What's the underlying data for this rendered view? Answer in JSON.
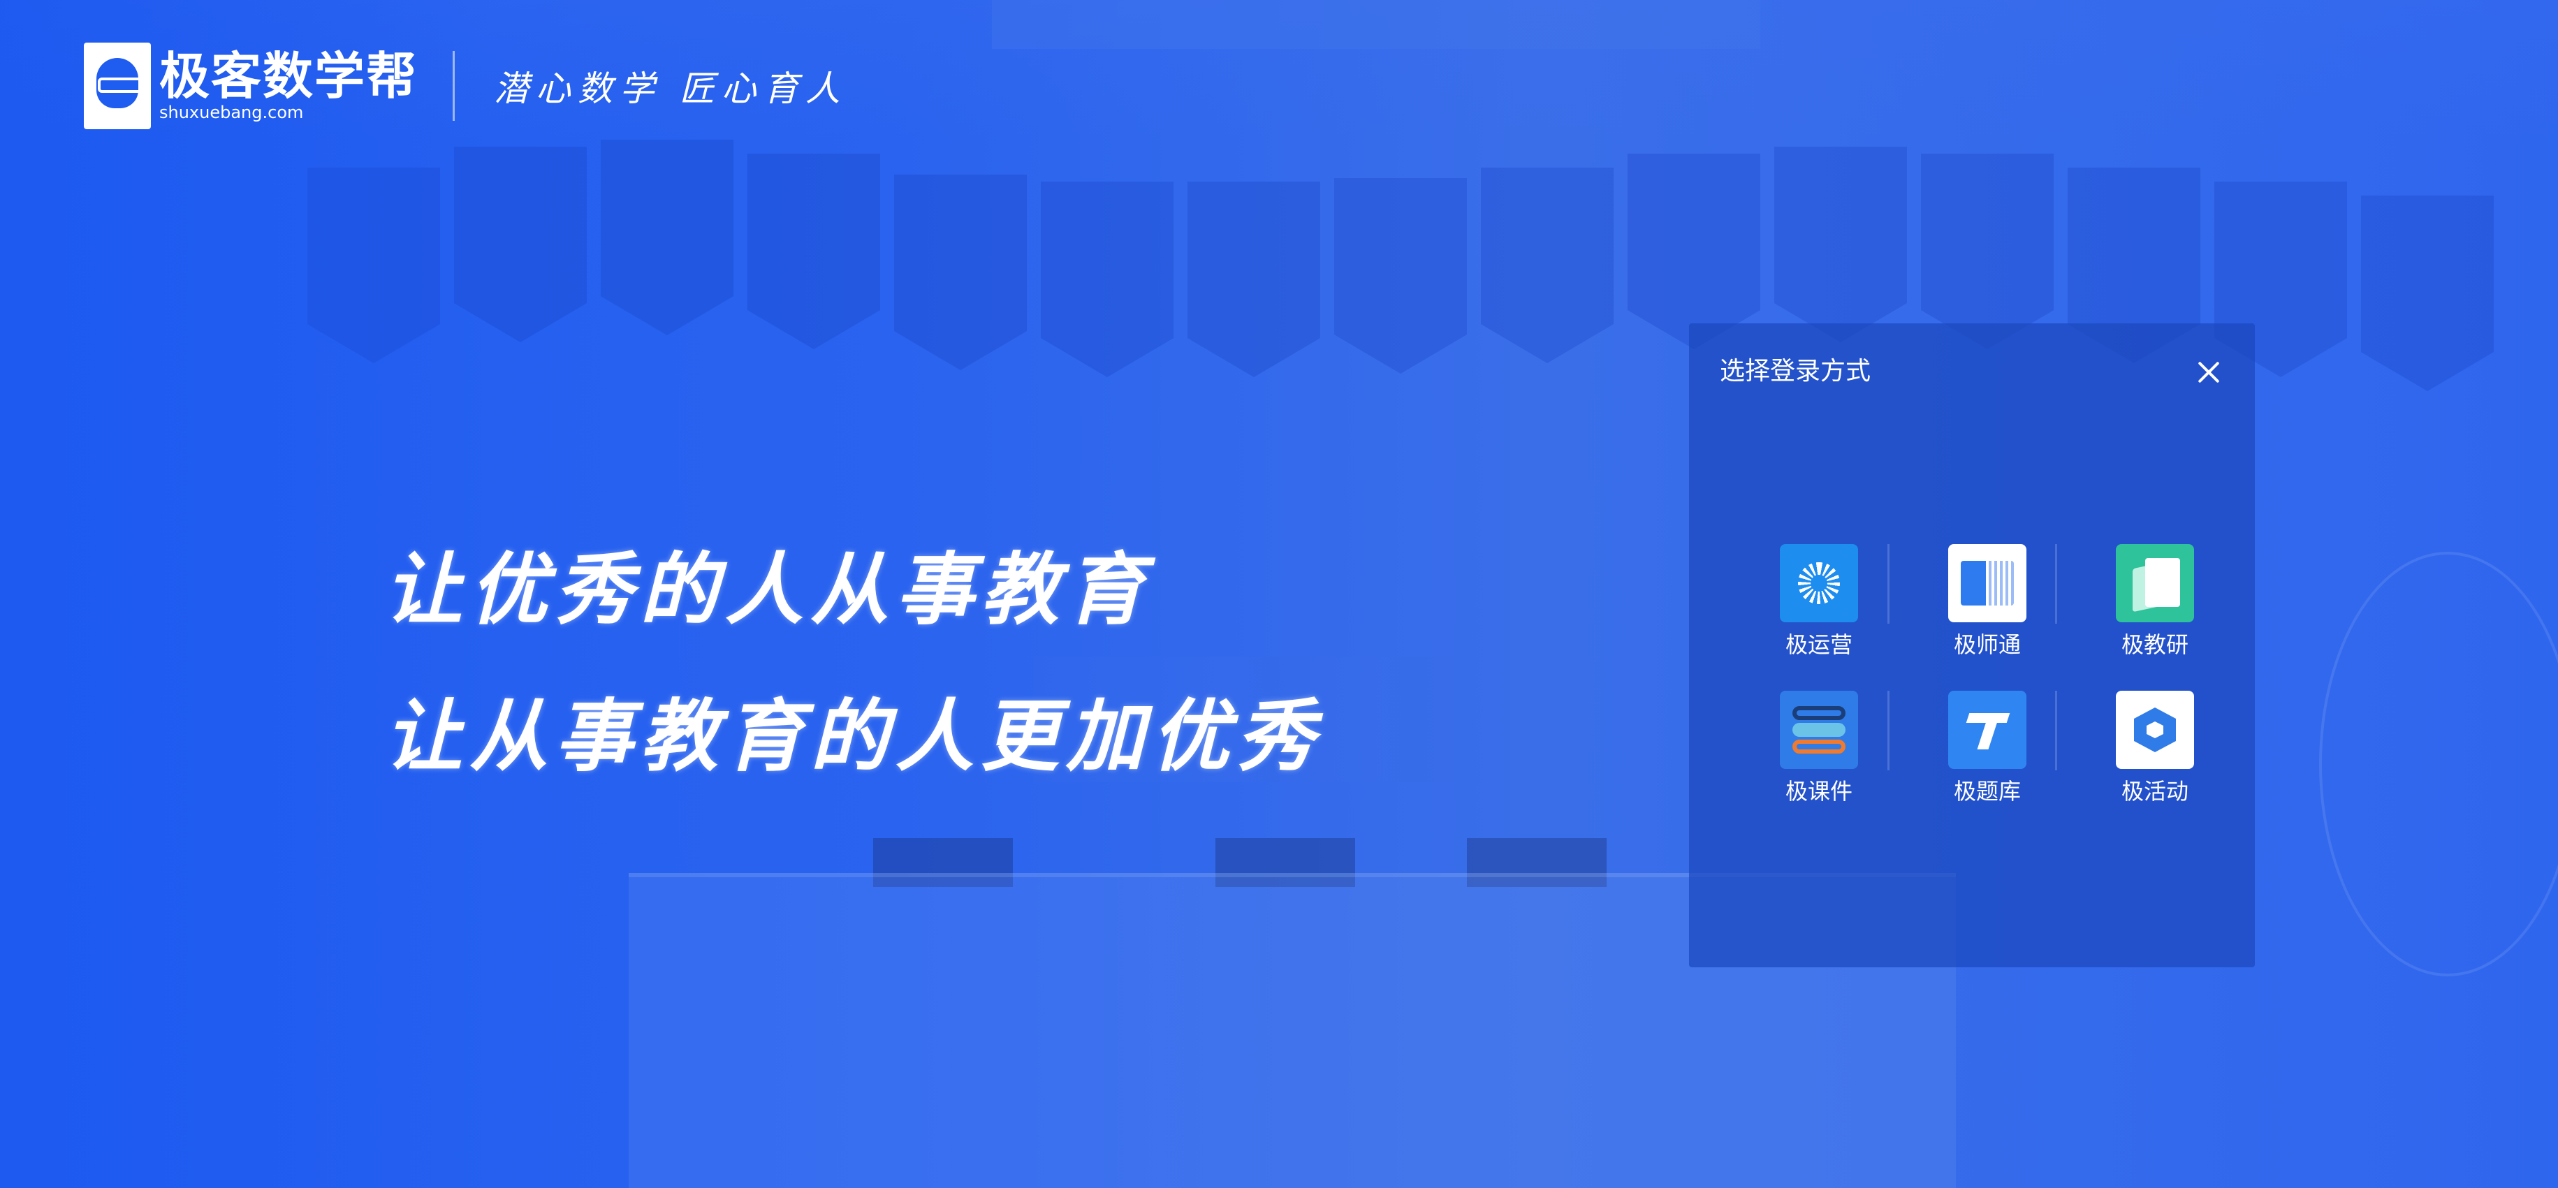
{
  "brand": {
    "name": "极客数学帮",
    "url": "shuxuebang.com",
    "slogan": "潜心数学 匠心育人"
  },
  "headline": {
    "line1": "让优秀的人从事教育",
    "line2": "让从事教育的人更加优秀"
  },
  "login_panel": {
    "title": "选择登录方式",
    "apps": [
      {
        "label": "极运营",
        "icon": "sunburst-icon"
      },
      {
        "label": "极师通",
        "icon": "open-book-icon"
      },
      {
        "label": "极教研",
        "icon": "pages-icon"
      },
      {
        "label": "极课件",
        "icon": "stacked-bars-icon"
      },
      {
        "label": "极题库",
        "icon": "letter-t-icon"
      },
      {
        "label": "极活动",
        "icon": "hex-cube-icon"
      }
    ]
  },
  "colors": {
    "background": "#1f5cf0",
    "panel": "#1c48be",
    "text": "#ffffff"
  }
}
